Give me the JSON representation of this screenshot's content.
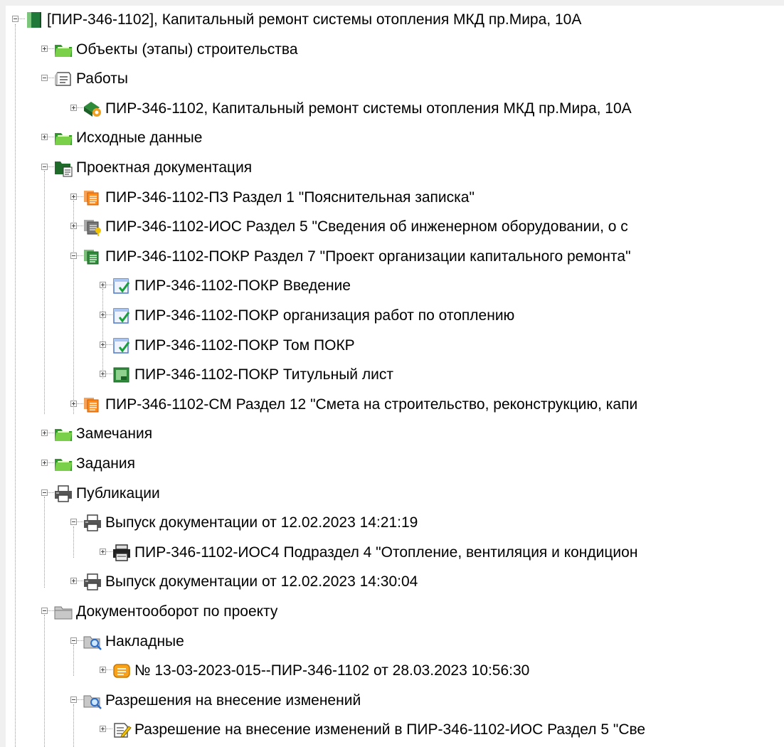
{
  "tree": {
    "nodes": [
      {
        "label": "[ПИР-346-1102], Капитальный ремонт системы отопления МКД пр.Мира, 10А",
        "icon": "project-book-icon",
        "expanded": true
      },
      {
        "label": "Объекты (этапы) строительства",
        "icon": "green-folder-icon",
        "expanded": false
      },
      {
        "label": "Работы",
        "icon": "works-list-icon",
        "expanded": true
      },
      {
        "label": "ПИР-346-1102, Капитальный ремонт системы отопления МКД пр.Мира, 10А",
        "icon": "work-task-icon",
        "expanded": false
      },
      {
        "label": "Исходные данные",
        "icon": "green-folder-icon",
        "expanded": false
      },
      {
        "label": "Проектная документация",
        "icon": "dark-green-doc-folder-icon",
        "expanded": true
      },
      {
        "label": "ПИР-346-1102-ПЗ Раздел 1 \"Пояснительная записка\"",
        "icon": "orange-doc-stack-icon",
        "expanded": false
      },
      {
        "label": "ПИР-346-1102-ИОС Раздел 5 \"Сведения об инженерном оборудовании, о с",
        "icon": "gray-doc-stack-key-icon",
        "expanded": false
      },
      {
        "label": "ПИР-346-1102-ПОКР Раздел 7 \"Проект организации капитального ремонта\"",
        "icon": "green-doc-stack-icon",
        "expanded": true
      },
      {
        "label": "ПИР-346-1102-ПОКР Введение",
        "icon": "approved-document-icon",
        "expanded": false
      },
      {
        "label": "ПИР-346-1102-ПОКР организация работ по отоплению",
        "icon": "approved-document-icon",
        "expanded": false
      },
      {
        "label": "ПИР-346-1102-ПОКР Том ПОКР",
        "icon": "approved-document-icon",
        "expanded": false
      },
      {
        "label": "ПИР-346-1102-ПОКР Титульный лист",
        "icon": "green-sheet-icon",
        "expanded": false
      },
      {
        "label": "ПИР-346-1102-СМ Раздел 12 \"Смета на строительство, реконструкцию, капи",
        "icon": "orange-doc-stack-icon",
        "expanded": false
      },
      {
        "label": "Замечания",
        "icon": "green-folder-icon",
        "expanded": false
      },
      {
        "label": "Задания",
        "icon": "green-folder-icon",
        "expanded": false
      },
      {
        "label": "Публикации",
        "icon": "printer-icon",
        "expanded": true
      },
      {
        "label": "Выпуск документации от 12.02.2023 14:21:19",
        "icon": "printer-icon",
        "expanded": true
      },
      {
        "label": "ПИР-346-1102-ИОС4 Подраздел 4 \"Отопление, вентиляция и кондицион",
        "icon": "print-job-icon",
        "expanded": false
      },
      {
        "label": "Выпуск документации от 12.02.2023 14:30:04",
        "icon": "printer-icon",
        "expanded": false
      },
      {
        "label": "Документооборот по проекту",
        "icon": "gray-folder-icon",
        "expanded": true
      },
      {
        "label": "Накладные",
        "icon": "search-folder-icon",
        "expanded": true
      },
      {
        "label": "№ 13-03-2023-015--ПИР-346-1102 от 28.03.2023 10:56:30",
        "icon": "waybill-icon",
        "expanded": false
      },
      {
        "label": "Разрешения на внесение изменений",
        "icon": "search-folder-icon",
        "expanded": true
      },
      {
        "label": "Разрешение на внесение изменений в ПИР-346-1102-ИОС Раздел 5 \"Све",
        "icon": "change-permit-icon",
        "expanded": false
      }
    ]
  }
}
